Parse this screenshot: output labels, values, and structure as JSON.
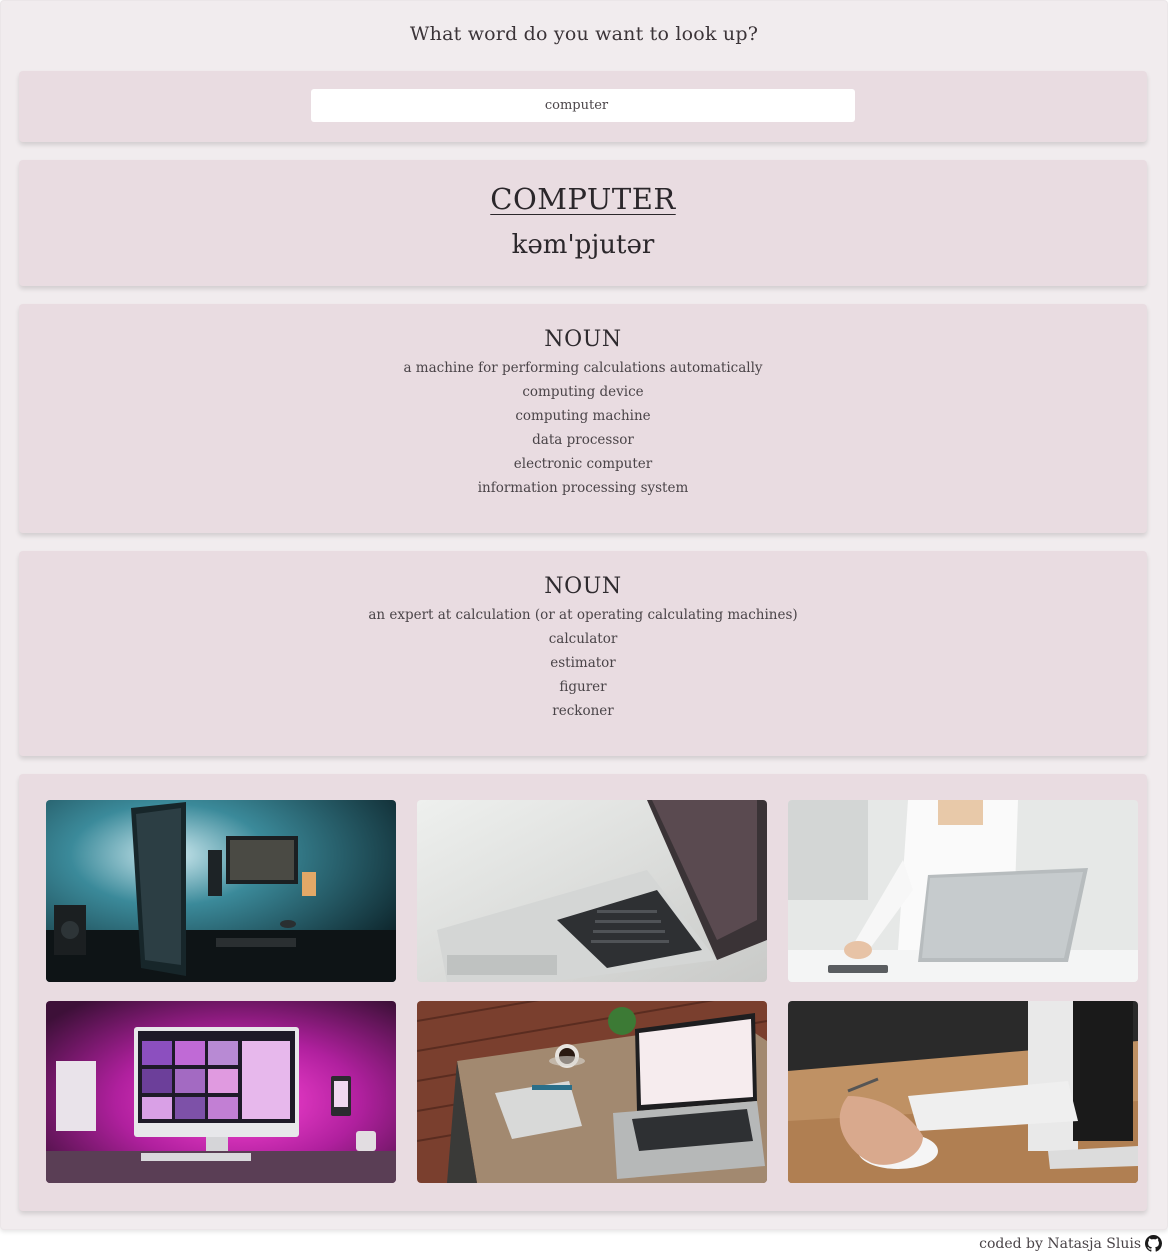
{
  "prompt": "What word do you want to look up?",
  "search": {
    "value": "computer"
  },
  "word": {
    "title": "COMPUTER",
    "phonetic": "kəm'pjutər"
  },
  "meanings": [
    {
      "part_of_speech": "NOUN",
      "definition": "a machine for performing calculations automatically",
      "synonyms": [
        "computing device",
        "computing machine",
        "data processor",
        "electronic computer",
        "information processing system"
      ]
    },
    {
      "part_of_speech": "NOUN",
      "definition": "an expert at calculation (or at operating calculating machines)",
      "synonyms": [
        "calculator",
        "estimator",
        "figurer",
        "reckoner"
      ]
    }
  ],
  "photos": [
    {
      "name": "desk-setup-teal-photo"
    },
    {
      "name": "laptop-keyboard-closeup-photo"
    },
    {
      "name": "woman-using-laptop-photo"
    },
    {
      "name": "imac-pink-setup-photo"
    },
    {
      "name": "laptop-on-wooden-table-photo"
    },
    {
      "name": "hand-on-mouse-photo"
    }
  ],
  "footer": {
    "text": "coded by Natasja Sluis",
    "icon": "github-icon"
  },
  "colors": {
    "page": "#f1ecee",
    "card": "#e9dce1",
    "text": "#2e2a30"
  }
}
